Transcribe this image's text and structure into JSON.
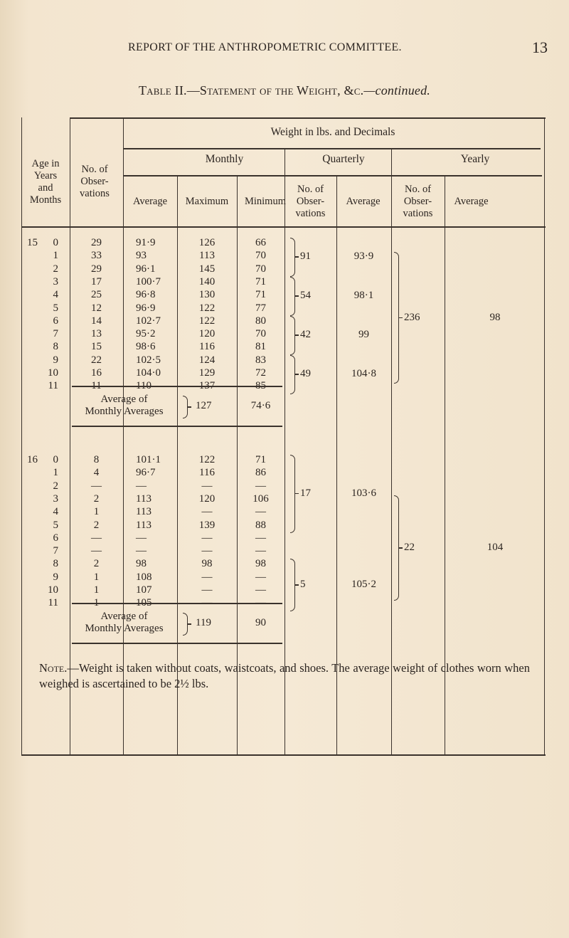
{
  "running_head": {
    "title": "REPORT OF THE ANTHROPOMETRIC COMMITTEE.",
    "page_number": "13"
  },
  "caption": {
    "table_label": "Table II.",
    "dash": "—",
    "title": "Statement of the Weight, &c.",
    "continued": "—continued."
  },
  "headers": {
    "age": [
      "Age in",
      "Years",
      "and",
      "Months"
    ],
    "observations": [
      "No. of",
      "Obser-",
      "vations"
    ],
    "weight_group": "Weight in lbs. and Decimals",
    "monthly": "Monthly",
    "quarterly": "Quarterly",
    "yearly": "Yearly",
    "average": "Average",
    "maximum": "Maximum",
    "minimum": "Minimum",
    "q_obs": [
      "No. of",
      "Obser-",
      "vations"
    ],
    "q_avg": "Average",
    "y_obs": [
      "No. of",
      "Obser-",
      "vations"
    ],
    "y_avg": "Average"
  },
  "sections": [
    {
      "year": "15",
      "rows": [
        {
          "month": "0",
          "obs": "29",
          "avg": "91·9",
          "max": "126",
          "min": "66"
        },
        {
          "month": "1",
          "obs": "33",
          "avg": "93",
          "max": "113",
          "min": "70"
        },
        {
          "month": "2",
          "obs": "29",
          "avg": "96·1",
          "max": "145",
          "min": "70"
        },
        {
          "month": "3",
          "obs": "17",
          "avg": "100·7",
          "max": "140",
          "min": "71"
        },
        {
          "month": "4",
          "obs": "25",
          "avg": "96·8",
          "max": "130",
          "min": "71"
        },
        {
          "month": "5",
          "obs": "12",
          "avg": "96·9",
          "max": "122",
          "min": "77"
        },
        {
          "month": "6",
          "obs": "14",
          "avg": "102·7",
          "max": "122",
          "min": "80"
        },
        {
          "month": "7",
          "obs": "13",
          "avg": "95·2",
          "max": "120",
          "min": "70"
        },
        {
          "month": "8",
          "obs": "15",
          "avg": "98·6",
          "max": "116",
          "min": "81"
        },
        {
          "month": "9",
          "obs": "22",
          "avg": "102·5",
          "max": "124",
          "min": "83"
        },
        {
          "month": "10",
          "obs": "16",
          "avg": "104·0",
          "max": "129",
          "min": "72"
        },
        {
          "month": "11",
          "obs": "11",
          "avg": "110",
          "max": "137",
          "min": "85"
        }
      ],
      "quarterly": [
        {
          "obs": "91",
          "avg": "93·9"
        },
        {
          "obs": "54",
          "avg": "98·1"
        },
        {
          "obs": "42",
          "avg": "99"
        },
        {
          "obs": "49",
          "avg": "104·8"
        }
      ],
      "yearly": {
        "obs": "236",
        "avg": "98"
      },
      "summary": {
        "label": [
          "Average of",
          "Monthly Averages"
        ],
        "max": "127",
        "min": "74·6"
      }
    },
    {
      "year": "16",
      "rows": [
        {
          "month": "0",
          "obs": "8",
          "avg": "101·1",
          "max": "122",
          "min": "71"
        },
        {
          "month": "1",
          "obs": "4",
          "avg": "96·7",
          "max": "116",
          "min": "86"
        },
        {
          "month": "2",
          "obs": "—",
          "avg": "—",
          "max": "—",
          "min": "—"
        },
        {
          "month": "3",
          "obs": "2",
          "avg": "113",
          "max": "120",
          "min": "106"
        },
        {
          "month": "4",
          "obs": "1",
          "avg": "113",
          "max": "—",
          "min": "—"
        },
        {
          "month": "5",
          "obs": "2",
          "avg": "113",
          "max": "139",
          "min": "88"
        },
        {
          "month": "6",
          "obs": "—",
          "avg": "—",
          "max": "—",
          "min": "—"
        },
        {
          "month": "7",
          "obs": "—",
          "avg": "—",
          "max": "—",
          "min": "—"
        },
        {
          "month": "8",
          "obs": "2",
          "avg": "98",
          "max": "98",
          "min": "98"
        },
        {
          "month": "9",
          "obs": "1",
          "avg": "108",
          "max": "—",
          "min": "—"
        },
        {
          "month": "10",
          "obs": "1",
          "avg": "107",
          "max": "—",
          "min": "—"
        },
        {
          "month": "11",
          "obs": "1",
          "avg": "105",
          "max": "—",
          "min": "—"
        }
      ],
      "quarterly": [
        {
          "obs": "17",
          "avg": "103·6"
        },
        {
          "obs": "5",
          "avg": "105·2"
        }
      ],
      "yearly": {
        "obs": "22",
        "avg": "104"
      },
      "summary": {
        "label": [
          "Average of",
          "Monthly Averages"
        ],
        "max": "119",
        "min": "90"
      }
    }
  ],
  "note": {
    "lead": "Note.",
    "text": "—Weight is taken without coats, waistcoats, and shoes.  The average weight of clothes worn when weighed is ascertained to be 2½ lbs."
  }
}
